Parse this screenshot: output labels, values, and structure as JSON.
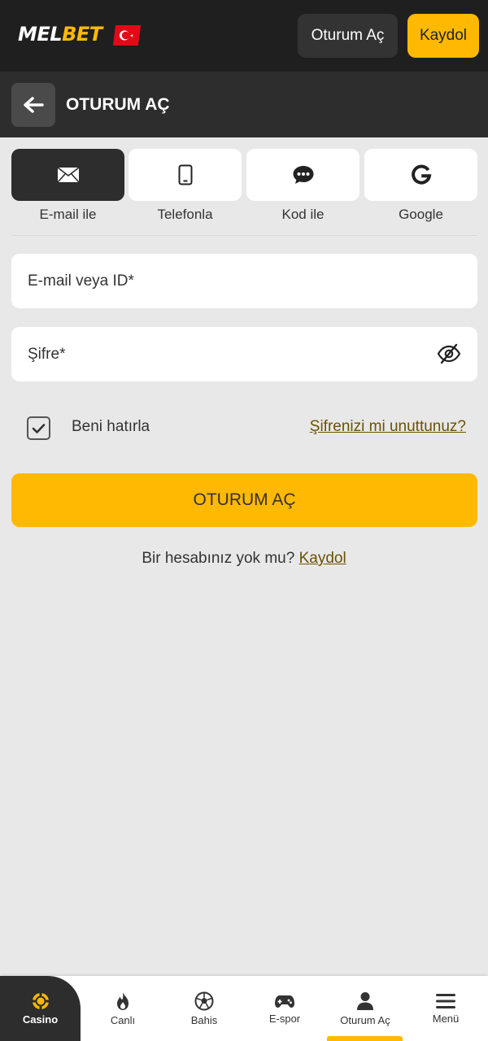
{
  "brand": {
    "logo_part1": "MEL",
    "logo_part2": "BET",
    "accent_color": "#ffb900"
  },
  "header": {
    "login_label": "Oturum Aç",
    "register_label": "Kaydol"
  },
  "titlebar": {
    "title": "OTURUM AÇ"
  },
  "login_methods": [
    {
      "label": "E-mail ile",
      "icon": "envelope-icon",
      "active": true
    },
    {
      "label": "Telefonla",
      "icon": "phone-icon",
      "active": false
    },
    {
      "label": "Kod ile",
      "icon": "chat-icon",
      "active": false
    },
    {
      "label": "Google",
      "icon": "google-icon",
      "active": false
    }
  ],
  "form": {
    "email_placeholder": "E-mail veya ID*",
    "password_placeholder": "Şifre*",
    "remember_label": "Beni hatırla",
    "remember_checked": true,
    "forgot_label": "Şifrenizi mi unuttunuz?",
    "submit_label": "OTURUM AÇ",
    "no_account_text": "Bir hesabınız yok mu?",
    "register_link": "Kaydol"
  },
  "bottom_nav": [
    {
      "label": "Casino",
      "icon": "casino-chip-icon",
      "active": true
    },
    {
      "label": "Canlı",
      "icon": "flame-icon",
      "active": false
    },
    {
      "label": "Bahis",
      "icon": "soccer-ball-icon",
      "active": false
    },
    {
      "label": "E-spor",
      "icon": "gamepad-icon",
      "active": false
    },
    {
      "label": "Oturum Aç",
      "icon": "user-icon",
      "active": false
    },
    {
      "label": "Menü",
      "icon": "hamburger-icon",
      "active": false
    }
  ]
}
